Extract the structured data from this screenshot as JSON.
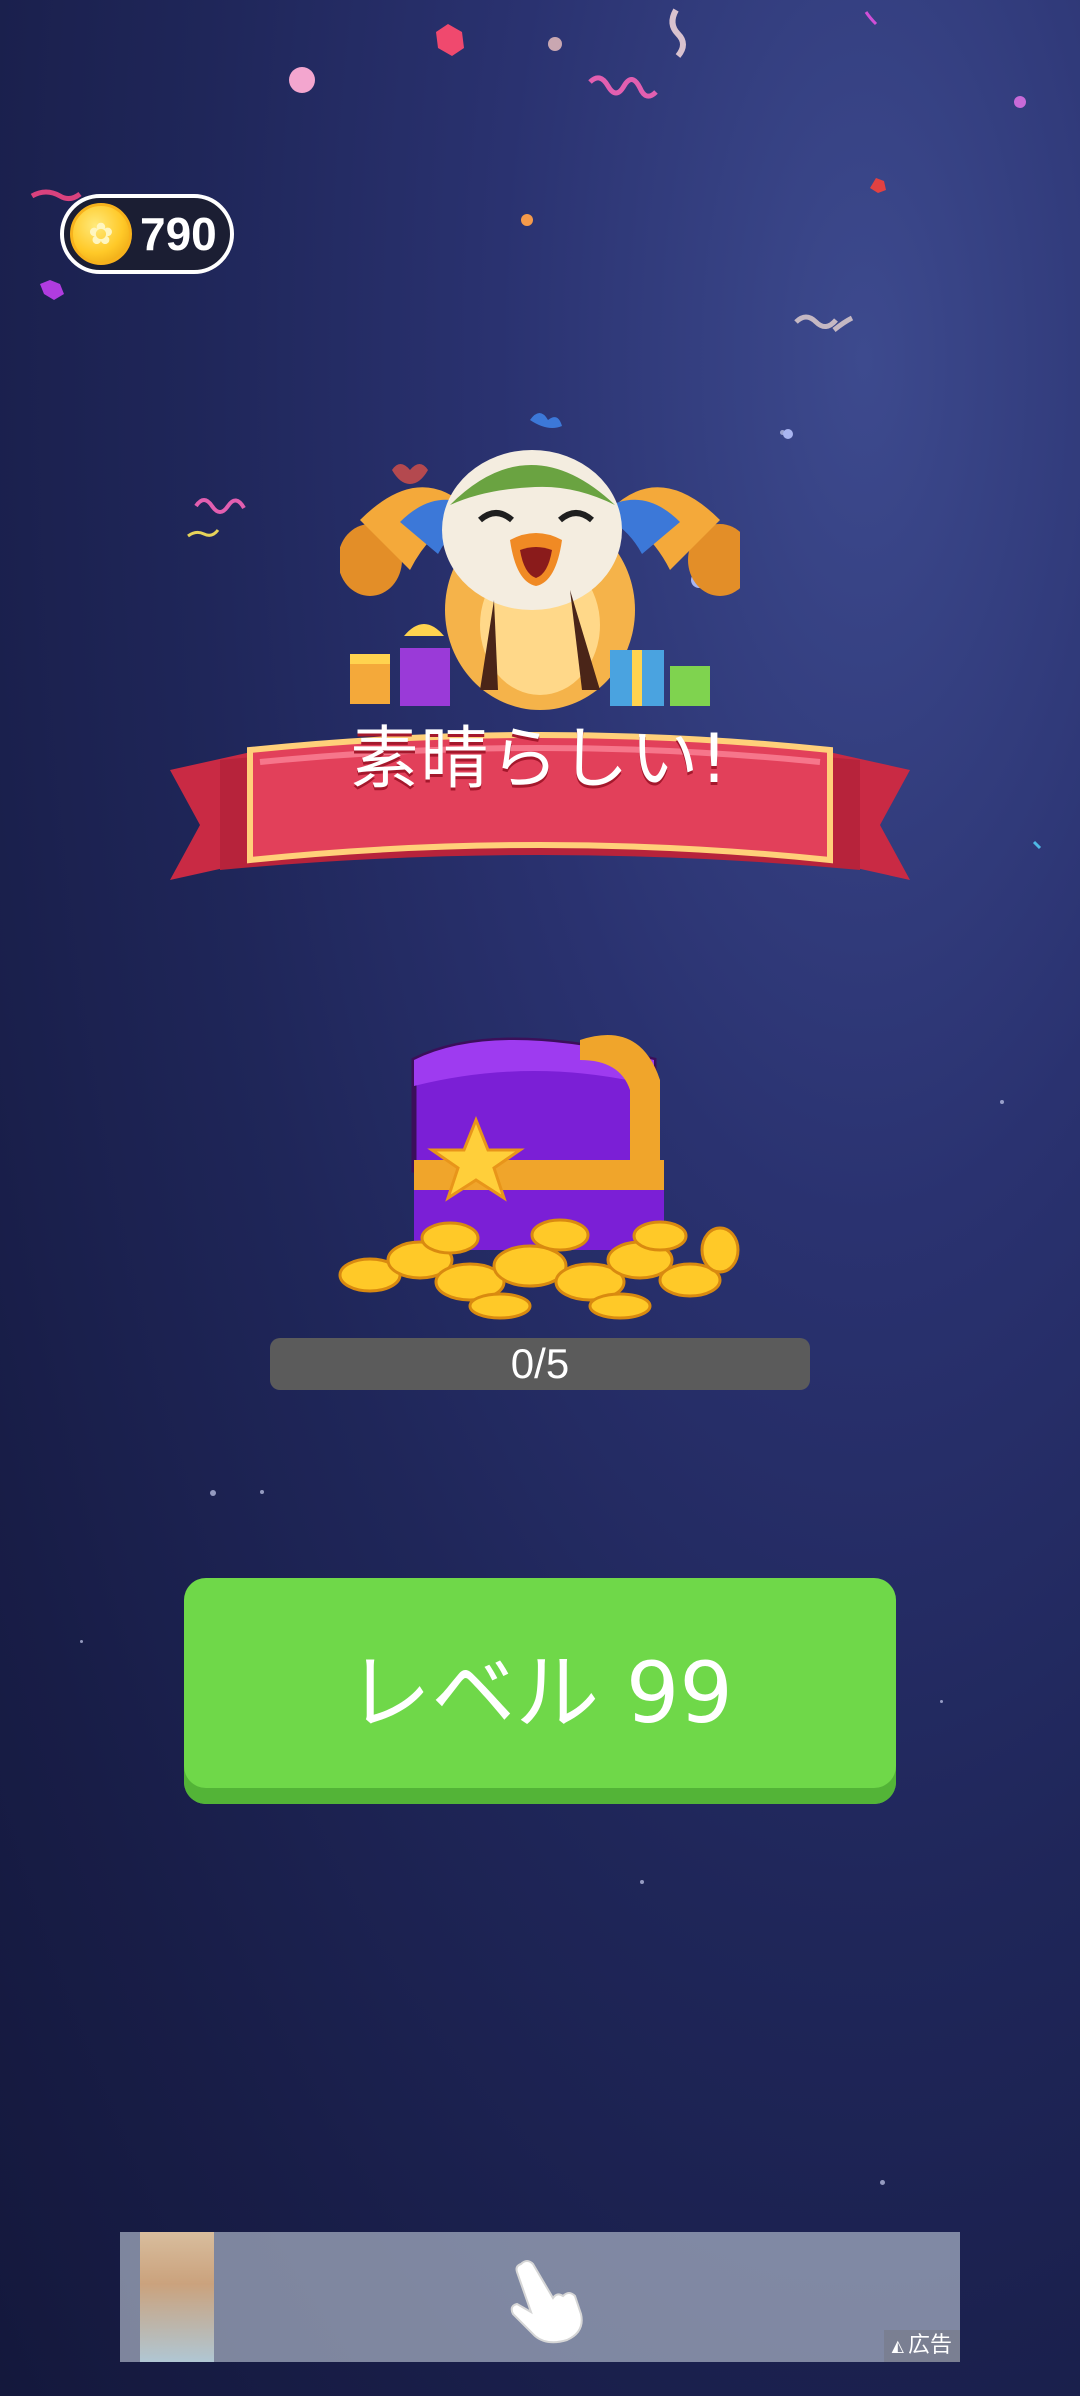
{
  "coins": {
    "icon": "coin-icon",
    "value": "790"
  },
  "banner": {
    "title": "素晴らしい!"
  },
  "mascot": {
    "icon": "cheering-bird-mascot"
  },
  "reward": {
    "icon": "treasure-chest-icon",
    "progress_text": "0/5",
    "progress_fraction": 0.0
  },
  "next_button": {
    "label": "レベル 99"
  },
  "ad": {
    "label": "広告",
    "icon": "tap-hand-icon"
  },
  "colors": {
    "background": "#1f2659",
    "button_green": "#6fd849",
    "ribbon_red": "#e2405a",
    "chest_purple": "#7b1fd6",
    "gold": "#ffc928"
  }
}
